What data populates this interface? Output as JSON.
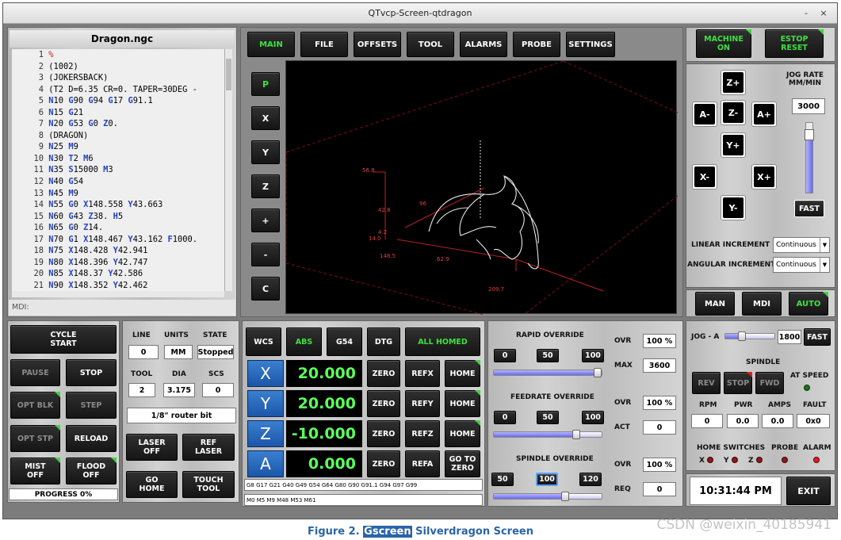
{
  "window": {
    "title": "QTvcp-Screen-qtdragon",
    "minimize": "-",
    "close": "×"
  },
  "file": {
    "name": "Dragon.ngc",
    "mdi_label": "MDI:"
  },
  "gcode_lines": [
    {
      "n": "1",
      "parts": [
        {
          "t": "%",
          "c": "r"
        }
      ]
    },
    {
      "n": "2",
      "parts": [
        {
          "t": "(1002)",
          "c": ""
        }
      ]
    },
    {
      "n": "3",
      "parts": [
        {
          "t": "(JOKERSBACK)",
          "c": ""
        }
      ]
    },
    {
      "n": "4",
      "parts": [
        {
          "t": "(T2  D=6.35 CR=0. TAPER=30DEG - ",
          "c": ""
        }
      ]
    },
    {
      "n": "5",
      "parts": [
        {
          "t": "N",
          "c": "g"
        },
        {
          "t": "10 ",
          "c": ""
        },
        {
          "t": "G",
          "c": "g"
        },
        {
          "t": "90 ",
          "c": ""
        },
        {
          "t": "G",
          "c": "g"
        },
        {
          "t": "94 ",
          "c": ""
        },
        {
          "t": "G",
          "c": "g"
        },
        {
          "t": "17 ",
          "c": ""
        },
        {
          "t": "G",
          "c": "g"
        },
        {
          "t": "91.1",
          "c": ""
        }
      ]
    },
    {
      "n": "6",
      "parts": [
        {
          "t": "N",
          "c": "g"
        },
        {
          "t": "15 ",
          "c": ""
        },
        {
          "t": "G",
          "c": "g"
        },
        {
          "t": "21",
          "c": ""
        }
      ]
    },
    {
      "n": "7",
      "parts": [
        {
          "t": "N",
          "c": "g"
        },
        {
          "t": "20 ",
          "c": ""
        },
        {
          "t": "G",
          "c": "g"
        },
        {
          "t": "53 ",
          "c": ""
        },
        {
          "t": "G",
          "c": "g"
        },
        {
          "t": "0 ",
          "c": ""
        },
        {
          "t": "Z",
          "c": "g"
        },
        {
          "t": "0.",
          "c": ""
        }
      ]
    },
    {
      "n": "8",
      "parts": [
        {
          "t": "(DRAGON)",
          "c": ""
        }
      ]
    },
    {
      "n": "9",
      "parts": [
        {
          "t": "N",
          "c": "g"
        },
        {
          "t": "25 ",
          "c": ""
        },
        {
          "t": "M",
          "c": "g"
        },
        {
          "t": "9",
          "c": ""
        }
      ]
    },
    {
      "n": "10",
      "parts": [
        {
          "t": "N",
          "c": "g"
        },
        {
          "t": "30 ",
          "c": ""
        },
        {
          "t": "T",
          "c": "g"
        },
        {
          "t": "2 ",
          "c": ""
        },
        {
          "t": "M",
          "c": "g"
        },
        {
          "t": "6",
          "c": ""
        }
      ]
    },
    {
      "n": "11",
      "parts": [
        {
          "t": "N",
          "c": "g"
        },
        {
          "t": "35 ",
          "c": ""
        },
        {
          "t": "S",
          "c": "g"
        },
        {
          "t": "15000 ",
          "c": ""
        },
        {
          "t": "M",
          "c": "g"
        },
        {
          "t": "3",
          "c": ""
        }
      ]
    },
    {
      "n": "12",
      "parts": [
        {
          "t": "N",
          "c": "g"
        },
        {
          "t": "40 ",
          "c": ""
        },
        {
          "t": "G",
          "c": "g"
        },
        {
          "t": "54",
          "c": ""
        }
      ]
    },
    {
      "n": "13",
      "parts": [
        {
          "t": "N",
          "c": "g"
        },
        {
          "t": "45 ",
          "c": ""
        },
        {
          "t": "M",
          "c": "g"
        },
        {
          "t": "9",
          "c": ""
        }
      ]
    },
    {
      "n": "14",
      "parts": [
        {
          "t": "N",
          "c": "g"
        },
        {
          "t": "55 ",
          "c": ""
        },
        {
          "t": "G",
          "c": "g"
        },
        {
          "t": "0 ",
          "c": ""
        },
        {
          "t": "X",
          "c": "g"
        },
        {
          "t": "148.558 ",
          "c": ""
        },
        {
          "t": "Y",
          "c": "g"
        },
        {
          "t": "43.663",
          "c": ""
        }
      ]
    },
    {
      "n": "15",
      "parts": [
        {
          "t": "N",
          "c": "g"
        },
        {
          "t": "60 ",
          "c": ""
        },
        {
          "t": "G",
          "c": "g"
        },
        {
          "t": "43 ",
          "c": ""
        },
        {
          "t": "Z",
          "c": "g"
        },
        {
          "t": "38. ",
          "c": ""
        },
        {
          "t": "H",
          "c": "g"
        },
        {
          "t": "5",
          "c": ""
        }
      ]
    },
    {
      "n": "16",
      "parts": [
        {
          "t": "N",
          "c": "g"
        },
        {
          "t": "65 ",
          "c": ""
        },
        {
          "t": "G",
          "c": "g"
        },
        {
          "t": "0 ",
          "c": ""
        },
        {
          "t": "Z",
          "c": "g"
        },
        {
          "t": "14.",
          "c": ""
        }
      ]
    },
    {
      "n": "17",
      "parts": [
        {
          "t": "N",
          "c": "g"
        },
        {
          "t": "70 ",
          "c": ""
        },
        {
          "t": "G",
          "c": "g"
        },
        {
          "t": "1 ",
          "c": ""
        },
        {
          "t": "X",
          "c": "g"
        },
        {
          "t": "148.467 ",
          "c": ""
        },
        {
          "t": "Y",
          "c": "g"
        },
        {
          "t": "43.162 ",
          "c": ""
        },
        {
          "t": "F",
          "c": "g"
        },
        {
          "t": "1000.",
          "c": ""
        }
      ]
    },
    {
      "n": "18",
      "parts": [
        {
          "t": "N",
          "c": "g"
        },
        {
          "t": "75 ",
          "c": ""
        },
        {
          "t": "X",
          "c": "g"
        },
        {
          "t": "148.428 ",
          "c": ""
        },
        {
          "t": "Y",
          "c": "g"
        },
        {
          "t": "42.941",
          "c": ""
        }
      ]
    },
    {
      "n": "19",
      "parts": [
        {
          "t": "N",
          "c": "g"
        },
        {
          "t": "80 ",
          "c": ""
        },
        {
          "t": "X",
          "c": "g"
        },
        {
          "t": "148.396 ",
          "c": ""
        },
        {
          "t": "Y",
          "c": "g"
        },
        {
          "t": "42.747",
          "c": ""
        }
      ]
    },
    {
      "n": "20",
      "parts": [
        {
          "t": "N",
          "c": "g"
        },
        {
          "t": "85 ",
          "c": ""
        },
        {
          "t": "X",
          "c": "g"
        },
        {
          "t": "148.37 ",
          "c": ""
        },
        {
          "t": "Y",
          "c": "g"
        },
        {
          "t": "42.586",
          "c": ""
        }
      ]
    },
    {
      "n": "21",
      "parts": [
        {
          "t": "N",
          "c": "g"
        },
        {
          "t": "90 ",
          "c": ""
        },
        {
          "t": "X",
          "c": "g"
        },
        {
          "t": "148.352 ",
          "c": ""
        },
        {
          "t": "Y",
          "c": "g"
        },
        {
          "t": "42.462",
          "c": ""
        }
      ]
    }
  ],
  "tabs": [
    "MAIN",
    "FILE",
    "OFFSETS",
    "TOOL",
    "ALARMS",
    "PROBE",
    "SETTINGS"
  ],
  "view_buttons": [
    "P",
    "X",
    "Y",
    "Z",
    "+",
    "-",
    "C"
  ],
  "preview_dims": {
    "d1": "56.8",
    "d2": "42.8",
    "d3": "14.0",
    "d4": "4.2",
    "d5": "148.5",
    "d6": "62.9",
    "d7": "209.7",
    "d8": "96"
  },
  "machine": {
    "machine_on": "MACHINE\nON",
    "estop": "ESTOP\nRESET"
  },
  "jog": {
    "rate_label": "JOG RATE\nMM/MIN",
    "rate_value": "3000",
    "fast": "FAST",
    "buttons": {
      "zp": "Z+",
      "zm": "Z-",
      "am": "A-",
      "ap": "A+",
      "yp": "Y+",
      "ym": "Y-",
      "xm": "X-",
      "xp": "X+"
    },
    "linear_label": "LINEAR INCREMENT",
    "linear_value": "Continuous",
    "angular_label": "ANGULAR INCREMENT",
    "angular_value": "Continuous"
  },
  "modes": [
    "MAN",
    "MDI",
    "AUTO"
  ],
  "cycle": {
    "start": "CYCLE\nSTART",
    "pause": "PAUSE",
    "stop": "STOP",
    "opt_blk": "OPT BLK",
    "step": "STEP",
    "opt_stp": "OPT STP",
    "reload": "RELOAD",
    "mist": "MIST\nOFF",
    "flood": "FLOOD\nOFF",
    "progress": "PROGRESS 0%"
  },
  "status": {
    "line_label": "LINE",
    "line": "0",
    "units_label": "UNITS",
    "units": "MM",
    "state_label": "STATE",
    "state": "Stopped",
    "tool_label": "TOOL",
    "tool": "2",
    "dia_label": "DIA",
    "dia": "3.175",
    "scs_label": "SCS",
    "scs": "0",
    "tool_desc": "1/8\" router bit",
    "laser_off": "LASER\nOFF",
    "ref_laser": "REF\nLASER",
    "go_home": "GO\nHOME",
    "touch_tool": "TOUCH\nTOOL"
  },
  "dro": {
    "wcs": "WCS",
    "abs": "ABS",
    "g54": "G54",
    "dtg": "DTG",
    "all_homed": "ALL HOMED",
    "axes": [
      {
        "name": "X",
        "value": "20.000",
        "ref": "REFX"
      },
      {
        "name": "Y",
        "value": "20.000",
        "ref": "REFY"
      },
      {
        "name": "Z",
        "value": "-10.000",
        "ref": "REFZ"
      },
      {
        "name": "A",
        "value": "0.000",
        "ref": "REFA"
      }
    ],
    "zero": "ZERO",
    "home": "HOME",
    "goto_zero": "GO TO\nZERO",
    "gcodes": "G8 G17 G21 G40 G49 G54 G64 G80 G90 G91.1 G94 G97 G99",
    "mcodes": "M0 M5 M9 M48 M53 M61"
  },
  "overrides": {
    "rapid_title": "RAPID OVERRIDE",
    "rapid_btns": [
      "0",
      "50",
      "100"
    ],
    "rapid_ovr_label": "OVR",
    "rapid_ovr": "100 %",
    "rapid_max_label": "MAX",
    "rapid_max": "3600",
    "rapid_level": 1.0,
    "feed_title": "FEEDRATE OVERRIDE",
    "feed_btns": [
      "0",
      "50",
      "100"
    ],
    "feed_ovr_label": "OVR",
    "feed_ovr": "100 %",
    "feed_act_label": "ACT",
    "feed_act": "0",
    "feed_level": 0.8,
    "spindle_title": "SPINDLE OVERRIDE",
    "spindle_btns": [
      "50",
      "100",
      "120"
    ],
    "spindle_ovr_label": "OVR",
    "spindle_ovr": "100 %",
    "spindle_req_label": "REQ",
    "spindle_req": "0",
    "spindle_level": 0.7
  },
  "spindle": {
    "jog_a_label": "JOG - A",
    "jog_a_value": "1800",
    "jog_a_fast": "FAST",
    "jog_a_level": 0.3,
    "title": "SPINDLE",
    "rev": "REV",
    "stop": "STOP",
    "fwd": "FWD",
    "at_speed": "AT SPEED",
    "rpm_label": "RPM",
    "rpm": "0",
    "pwr_label": "PWR",
    "pwr": "0.0",
    "amps_label": "AMPS",
    "amps": "0.0",
    "fault_label": "FAULT",
    "fault": "0x0",
    "home_switches": "HOME SWITCHES",
    "probe": "PROBE",
    "alarm": "ALARM",
    "hx": "X",
    "hy": "Y",
    "hz": "Z"
  },
  "clock": {
    "time": "10:31:44 PM",
    "exit": "EXIT"
  },
  "caption": {
    "pre": "Figure 2. ",
    "hl": "Gscreen",
    "post": " Silverdragon Screen"
  },
  "watermark": "CSDN @weixin_40185941",
  "colors": {
    "green_text": "#3fe040",
    "blue_gcode": "#2343c8",
    "led_green": "#2fbf2f",
    "led_red": "#e02020"
  }
}
